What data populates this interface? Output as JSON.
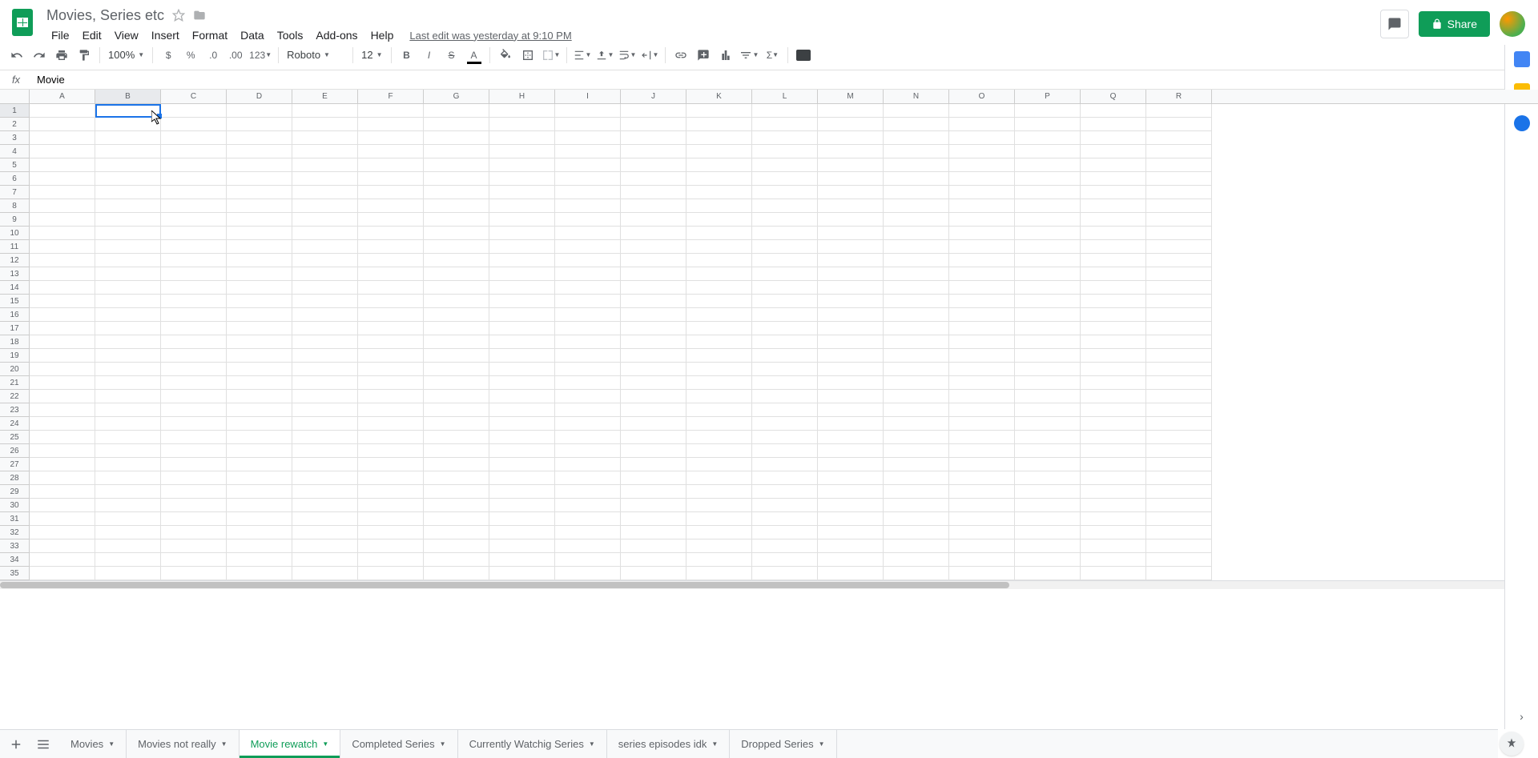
{
  "doc": {
    "title": "Movies, Series etc"
  },
  "menu": {
    "file": "File",
    "edit": "Edit",
    "view": "View",
    "insert": "Insert",
    "format": "Format",
    "data": "Data",
    "tools": "Tools",
    "addons": "Add-ons",
    "help": "Help",
    "last_edit": "Last edit was yesterday at 9:10 PM"
  },
  "header": {
    "share": "Share"
  },
  "toolbar": {
    "zoom": "100%",
    "123": "123",
    "font": "Roboto",
    "size": "12"
  },
  "fx": {
    "value": "Movie"
  },
  "columns": [
    "A",
    "B",
    "C",
    "D",
    "E",
    "F",
    "G",
    "H",
    "I",
    "J",
    "K",
    "L",
    "M",
    "N",
    "O",
    "P",
    "Q",
    "R"
  ],
  "rows": [
    "1",
    "2",
    "3",
    "4",
    "5",
    "6",
    "7",
    "8",
    "9",
    "10",
    "11",
    "12",
    "13",
    "14",
    "15",
    "16",
    "17",
    "18",
    "19",
    "20",
    "21",
    "22",
    "23",
    "24",
    "25",
    "26",
    "27",
    "28",
    "29",
    "30",
    "31",
    "32",
    "33",
    "34",
    "35"
  ],
  "selected": {
    "col": "B",
    "row": "1"
  },
  "tabs": [
    {
      "label": "Movies",
      "active": false
    },
    {
      "label": "Movies not really",
      "active": false
    },
    {
      "label": "Movie rewatch",
      "active": true
    },
    {
      "label": "Completed Series",
      "active": false
    },
    {
      "label": "Currently Watchig Series",
      "active": false
    },
    {
      "label": "series episodes idk",
      "active": false
    },
    {
      "label": "Dropped Series",
      "active": false
    }
  ]
}
